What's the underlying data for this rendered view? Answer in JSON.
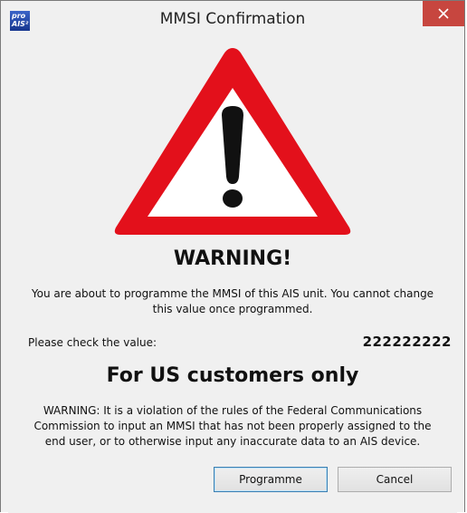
{
  "window": {
    "title": "MMSI Confirmation",
    "app_icon": {
      "line1": "pro",
      "line2": "AIS²",
      "icon": "proais-app-icon"
    },
    "close_icon": "close-icon",
    "accent_close": "#c7463f"
  },
  "dialog": {
    "warning_icon": "warning-triangle-icon",
    "heading": "WARNING!",
    "message": "You are about to programme the MMSI of this AIS unit. You cannot change this value once programmed.",
    "check_label": "Please check the value:",
    "mmsi_value": "222222222",
    "us_heading": "For US customers only",
    "fcc_warning": "WARNING: It is a violation of the rules of the Federal Communications Commission to input an MMSI that has not been properly assigned to the end user, or to otherwise input any inaccurate data to an AIS device."
  },
  "buttons": {
    "programme_label": "Programme",
    "cancel_label": "Cancel"
  },
  "colors": {
    "triangle_red": "#e3101b",
    "triangle_inner": "#ffffff",
    "exclamation": "#111111"
  }
}
